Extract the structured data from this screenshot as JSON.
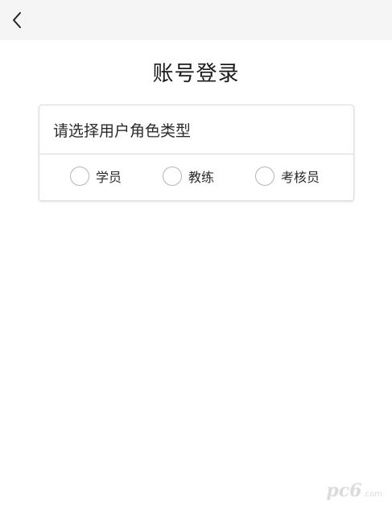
{
  "page": {
    "title": "账号登录"
  },
  "nav": {
    "back_icon": "chevron-left-icon"
  },
  "role_selector": {
    "prompt": "请选择用户角色类型",
    "options": [
      {
        "label": "学员",
        "selected": false
      },
      {
        "label": "教练",
        "selected": false
      },
      {
        "label": "考核员",
        "selected": false
      }
    ]
  },
  "watermark": {
    "logo_text": "pc6",
    "suffix": ".com"
  },
  "colors": {
    "topbar_bg": "#f5f5f5",
    "background": "#ffffff",
    "radio_border": "#b5b5b5"
  }
}
